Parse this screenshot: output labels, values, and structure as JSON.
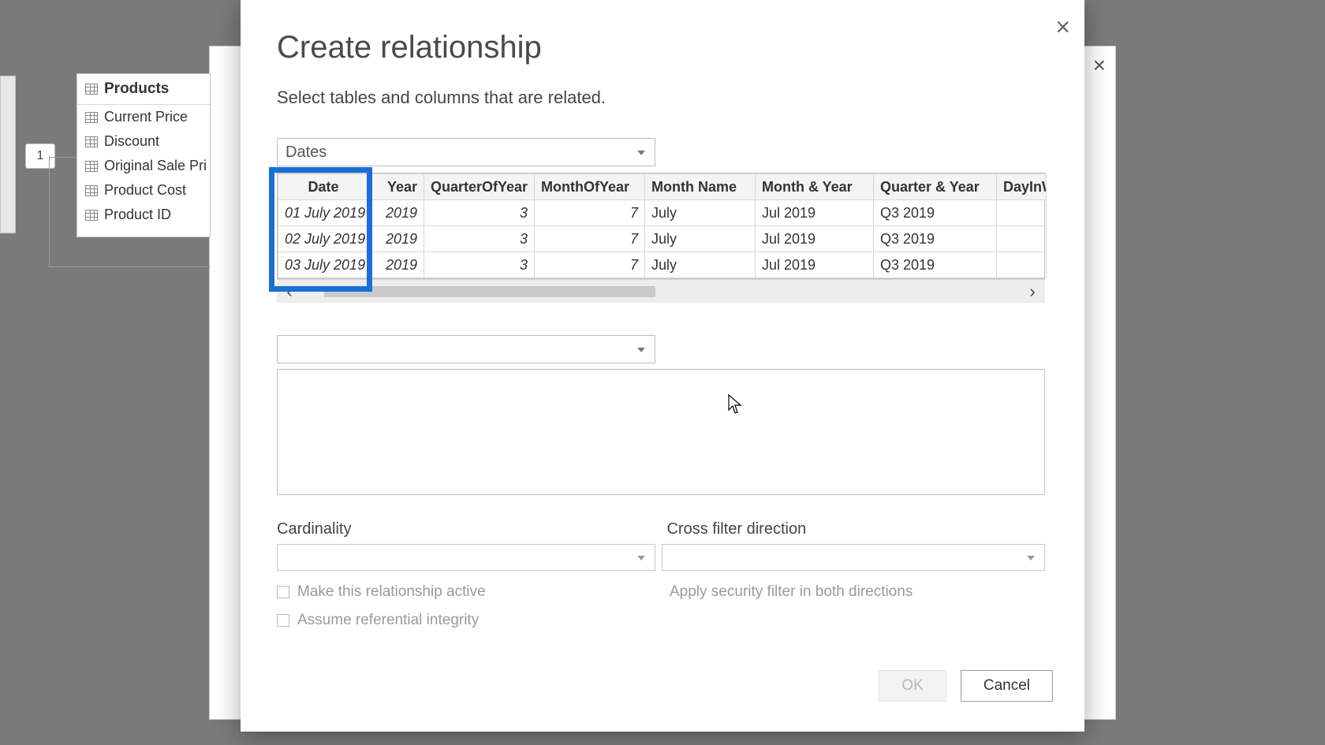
{
  "connector_badge": "1",
  "products_panel": {
    "title": "Products",
    "fields": [
      "Current Price",
      "Discount",
      "Original Sale Pri",
      "Product Cost",
      "Product ID"
    ]
  },
  "dialog": {
    "title": "Create relationship",
    "subtitle": "Select tables and columns that are related.",
    "table1_select": "Dates",
    "table2_select": "",
    "columns": [
      "Date",
      "Year",
      "QuarterOfYear",
      "MonthOfYear",
      "Month Name",
      "Month & Year",
      "Quarter & Year",
      "DayInW"
    ],
    "rows": [
      {
        "date": "01 July 2019",
        "year": "2019",
        "q": "3",
        "m": "7",
        "mname": "July",
        "my": "Jul 2019",
        "qy": "Q3 2019"
      },
      {
        "date": "02 July 2019",
        "year": "2019",
        "q": "3",
        "m": "7",
        "mname": "July",
        "my": "Jul 2019",
        "qy": "Q3 2019"
      },
      {
        "date": "03 July 2019",
        "year": "2019",
        "q": "3",
        "m": "7",
        "mname": "July",
        "my": "Jul 2019",
        "qy": "Q3 2019"
      }
    ],
    "cardinality_label": "Cardinality",
    "crossfilter_label": "Cross filter direction",
    "cardinality_value": "",
    "crossfilter_value": "",
    "chk_active": "Make this relationship active",
    "chk_integrity": "Assume referential integrity",
    "chk_security": "Apply security filter in both directions",
    "ok": "OK",
    "cancel": "Cancel"
  }
}
